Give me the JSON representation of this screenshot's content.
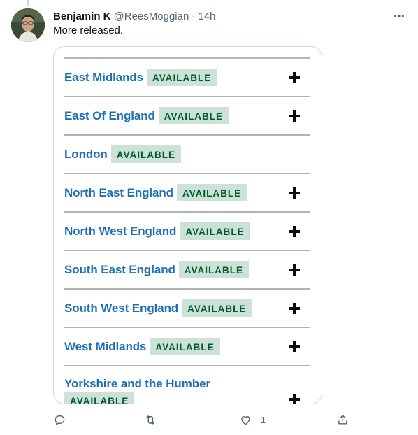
{
  "tweet": {
    "author_name": "Benjamin K",
    "author_handle": "@ReesMoggian",
    "separator": "·",
    "time": "14h",
    "text": "More released.",
    "like_count": "1"
  },
  "media": {
    "regions": [
      {
        "name": "East Midlands",
        "status": "AVAILABLE",
        "expandable": true
      },
      {
        "name": "East Of England",
        "status": "AVAILABLE",
        "expandable": true
      },
      {
        "name": "London",
        "status": "AVAILABLE",
        "expandable": false
      },
      {
        "name": "North East England",
        "status": "AVAILABLE",
        "expandable": true
      },
      {
        "name": "North West England",
        "status": "AVAILABLE",
        "expandable": true
      },
      {
        "name": "South East England",
        "status": "AVAILABLE",
        "expandable": true
      },
      {
        "name": "South West England",
        "status": "AVAILABLE",
        "expandable": true
      },
      {
        "name": "West Midlands",
        "status": "AVAILABLE",
        "expandable": true
      },
      {
        "name": "Yorkshire and the Humber",
        "status": "AVAILABLE",
        "expandable": true
      }
    ]
  },
  "icons": {
    "more": "more-icon",
    "reply": "reply-icon",
    "retweet": "retweet-icon",
    "like": "heart-icon",
    "share": "share-icon",
    "expand": "plus-icon"
  },
  "colors": {
    "link_blue": "#1d70b8",
    "tag_bg": "#cce2d8",
    "tag_text": "#005a30",
    "divider": "#b1b4b6",
    "secondary_text": "#536471"
  }
}
